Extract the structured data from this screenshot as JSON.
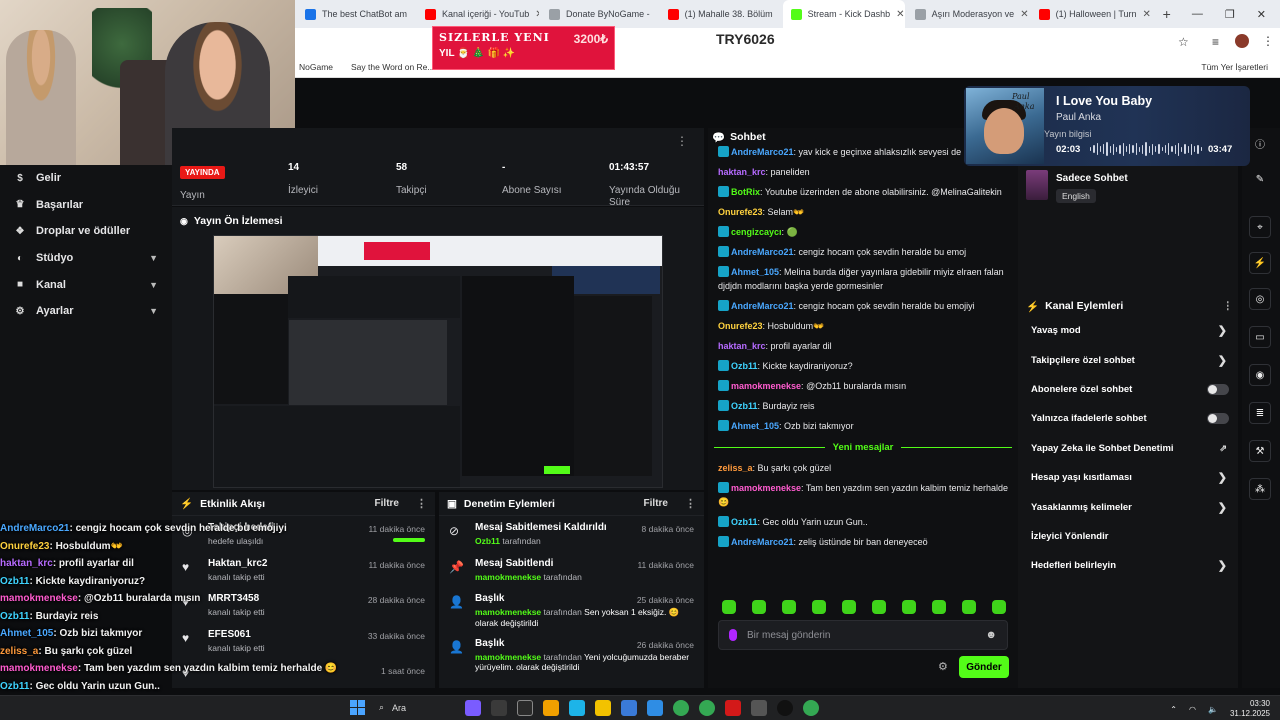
{
  "browser": {
    "tabs": [
      {
        "label": "The best ChatBot am",
        "color": "#1a73e8"
      },
      {
        "label": "Kanal içeriği - YouTub",
        "color": "#ff0000"
      },
      {
        "label": "Donate ByNoGame -",
        "color": "#9aa0a6"
      },
      {
        "label": "(1) Mahalle 38. Bölüm",
        "color": "#ff0000"
      },
      {
        "label": "Stream - Kick Dashb",
        "color": "#53fc18"
      },
      {
        "label": "Aşırı Moderasyon ve",
        "color": "#9aa0a6"
      },
      {
        "label": "(1) Halloween | Turn",
        "color": "#ff0000"
      }
    ],
    "bookmarks": [
      "NoGame",
      "Say the Word on Re..."
    ],
    "bookmarks_right": "Tüm Yer İşaretleri"
  },
  "alert": {
    "line1": "SIZLERLE YENI",
    "amount": "3200₺",
    "line2": "YIL 🎅 🎄  🎁  ✨"
  },
  "overlay_amount": "TRY6026",
  "music": {
    "title": "I Love You Baby",
    "artist": "Paul Anka",
    "elapsed": "02:03",
    "total": "03:47",
    "album_line1": "Paul",
    "album_line2": "Anka",
    "ghost_label": "Yayın bilgisi"
  },
  "sidebar": {
    "items": [
      {
        "label": "Gelir",
        "icon": "dollar-icon",
        "glyph": "$",
        "chevron": false
      },
      {
        "label": "Başarılar",
        "icon": "trophy-icon",
        "glyph": "♛",
        "chevron": false
      },
      {
        "label": "Droplar ve ödüller",
        "icon": "gift-icon",
        "glyph": "❖",
        "chevron": false
      },
      {
        "label": "Stüdyo",
        "icon": "palette-icon",
        "glyph": "◐",
        "chevron": true
      },
      {
        "label": "Kanal",
        "icon": "channel-icon",
        "glyph": "■",
        "chevron": true
      },
      {
        "label": "Ayarlar",
        "icon": "gear-icon",
        "glyph": "⚙",
        "chevron": true
      }
    ]
  },
  "stats": {
    "live_badge": "YAYINDA",
    "status_label": "Yayın",
    "viewers_value": "14",
    "viewers_label": "İzleyici",
    "followers_value": "58",
    "followers_label": "Takipçi",
    "subs_value": "-",
    "subs_label": "Abone Sayısı",
    "uptime_value": "01:43:57",
    "uptime_label": "Yayında Olduğu Süre"
  },
  "preview": {
    "title": "Yayın Ön İzlemesi"
  },
  "activity": {
    "title": "Etkinlik Akışı",
    "filter": "Filtre",
    "rows": [
      {
        "title": "Takipçi hedefi",
        "sub": "hedefe ulaşıldı",
        "time": "11 dakika önce",
        "icon": "target-icon",
        "glyph": "◎"
      },
      {
        "title": "Haktan_krc2",
        "sub": "kanalı takip etti",
        "time": "11 dakika önce",
        "icon": "heart-icon",
        "glyph": "♥"
      },
      {
        "title": "MRRT3458",
        "sub": "kanalı takip etti",
        "time": "28 dakika önce",
        "icon": "heart-icon",
        "glyph": "♥"
      },
      {
        "title": "EFES061",
        "sub": "kanalı takip etti",
        "time": "33 dakika önce",
        "icon": "heart-icon",
        "glyph": "♥"
      },
      {
        "title": "",
        "sub": "",
        "time": "1 saat önce",
        "icon": "heart-icon",
        "glyph": "♥"
      }
    ],
    "goal_progress": 1.0
  },
  "mod": {
    "title": "Denetim Eylemleri",
    "filter": "Filtre",
    "rows": [
      {
        "title": "Mesaj Sabitlemesi Kaldırıldı",
        "user": "Ozb11",
        "suffix": " tarafından",
        "extra": "",
        "time": "8 dakika önce",
        "icon": "unpin-icon",
        "glyph": "⊘"
      },
      {
        "title": "Mesaj Sabitlendi",
        "user": "mamokmenekse",
        "suffix": " tarafından",
        "extra": "",
        "time": "11 dakika önce",
        "icon": "pin-icon",
        "glyph": "📌"
      },
      {
        "title": "Başlık",
        "user": "mamokmenekse",
        "suffix": " tarafından ",
        "extra": "Sen yoksan 1 eksiğiz. 😊 olarak değiştirildi",
        "time": "25 dakika önce",
        "icon": "user-edit-icon",
        "glyph": "👤"
      },
      {
        "title": "Başlık",
        "user": "mamokmenekse",
        "suffix": " tarafından ",
        "extra": "Yeni yolcuğumuzda beraber yürüyelim. olarak değiştirildi",
        "time": "26 dakika önce",
        "icon": "user-edit-icon",
        "glyph": "👤"
      }
    ]
  },
  "overlay_chat": [
    {
      "user": "AndreMarco21",
      "color": "#4aa8ff",
      "text": "cengiz hocam çok sevdin heralde bu emojiyi"
    },
    {
      "user": "Onurefe23",
      "color": "#ffd23f",
      "text": "Hosbuldum👐"
    },
    {
      "user": "haktan_krc",
      "color": "#b66bff",
      "text": "profil ayarlar dil"
    },
    {
      "user": "Ozb11",
      "color": "#3fd4ff",
      "text": "Kickte kaydiraniyoruz?"
    },
    {
      "user": "mamokmenekse",
      "color": "#ff5ccf",
      "text": "@Ozb11 buralarda mısın"
    },
    {
      "user": "Ozb11",
      "color": "#3fd4ff",
      "text": "Burdayiz reis"
    },
    {
      "user": "Ahmet_105",
      "color": "#4aa8ff",
      "text": "Ozb bizi takmıyor"
    },
    {
      "user": "zeliss_a",
      "color": "#ff9a3c",
      "text": "Bu şarkı çok güzel"
    },
    {
      "user": "mamokmenekse",
      "color": "#ff5ccf",
      "text": "Tam ben yazdım sen yazdın kalbim temiz herhalde 😊"
    },
    {
      "user": "Ozb11",
      "color": "#3fd4ff",
      "text": "Gec oldu Yarin uzun Gun.."
    }
  ],
  "chat": {
    "title": "Sohbet",
    "messages": [
      {
        "user": "AndreMarco21",
        "color": "#4aa8ff",
        "text": "yav kick e geçinxe ahlaksızlık sevyesi de uçtu be",
        "badge": true
      },
      {
        "user": "haktan_krc",
        "color": "#b66bff",
        "text": "paneliden",
        "badge": false
      },
      {
        "user": "BotRix",
        "color": "#53fc18",
        "text": "Youtube üzerinden de abone olabilirsiniz. @MelinaGalitekin",
        "badge": true
      },
      {
        "user": "Onurefe23",
        "color": "#ffd23f",
        "text": "Selam👐",
        "badge": false
      },
      {
        "user": "cengizcaycı",
        "color": "#53fc18",
        "text": "🟢",
        "badge": true
      },
      {
        "user": "AndreMarco21",
        "color": "#4aa8ff",
        "text": "cengiz hocam çok sevdin heralde bu emoj",
        "badge": true
      },
      {
        "user": "Ahmet_105",
        "color": "#4aa8ff",
        "text": "Melina burda diğer yayınlara gidebilir miyiz elraen falan djdjdn modlarını başka yerde gormesinler",
        "badge": true
      },
      {
        "user": "AndreMarco21",
        "color": "#4aa8ff",
        "text": "cengiz hocam çok sevdin heralde bu emojiyi",
        "badge": true
      },
      {
        "user": "Onurefe23",
        "color": "#ffd23f",
        "text": "Hosbuldum👐",
        "badge": false
      },
      {
        "user": "haktan_krc",
        "color": "#b66bff",
        "text": "profil ayarlar dil",
        "badge": false
      },
      {
        "user": "Ozb11",
        "color": "#3fd4ff",
        "text": "Kickte kaydiraniyoruz?",
        "badge": true
      },
      {
        "user": "mamokmenekse",
        "color": "#ff5ccf",
        "text": "@Ozb11 buralarda mısın",
        "badge": true
      },
      {
        "user": "Ozb11",
        "color": "#3fd4ff",
        "text": "Burdayiz reis",
        "badge": true
      },
      {
        "user": "Ahmet_105",
        "color": "#4aa8ff",
        "text": "Ozb bizi takmıyor",
        "badge": true
      }
    ],
    "new_label": "Yeni mesajlar",
    "new_messages": [
      {
        "user": "zeliss_a",
        "color": "#ff9a3c",
        "text": "Bu şarkı çok güzel",
        "badge": false
      },
      {
        "user": "mamokmenekse",
        "color": "#ff5ccf",
        "text": "Tam ben yazdım sen yazdın kalbim temiz herhalde 😊",
        "badge": true
      },
      {
        "user": "Ozb11",
        "color": "#3fd4ff",
        "text": "Gec oldu Yarin uzun Gun..",
        "badge": true
      },
      {
        "user": "AndreMarco21",
        "color": "#4aa8ff",
        "text": "zeliş üstünde bir ban deneyeceö",
        "badge": true
      }
    ],
    "input_placeholder": "Bir mesaj gönderin",
    "send_label": "Gönder"
  },
  "stream_info": {
    "title": "Sadece Sohbet",
    "language": "English"
  },
  "channel_actions": {
    "title": "Kanal Eylemleri",
    "items": [
      {
        "label": "Yavaş mod",
        "control": "chevron"
      },
      {
        "label": "Takipçilere özel sohbet",
        "control": "chevron"
      },
      {
        "label": "Abonelere özel sohbet",
        "control": "toggle"
      },
      {
        "label": "Yalnızca ifadelerle sohbet",
        "control": "toggle"
      },
      {
        "label": "Yapay Zeka ile Sohbet Denetimi",
        "control": "external"
      },
      {
        "label": "Hesap yaşı kısıtlaması",
        "control": "chevron"
      },
      {
        "label": "Yasaklanmış kelimeler",
        "control": "chevron"
      },
      {
        "label": "İzleyici Yönlendir",
        "control": "none"
      },
      {
        "label": "Hedefleri belirleyin",
        "control": "chevron"
      }
    ]
  },
  "taskbar": {
    "search_label": "Ara",
    "time": "03:30",
    "date": "31.12.2025"
  }
}
